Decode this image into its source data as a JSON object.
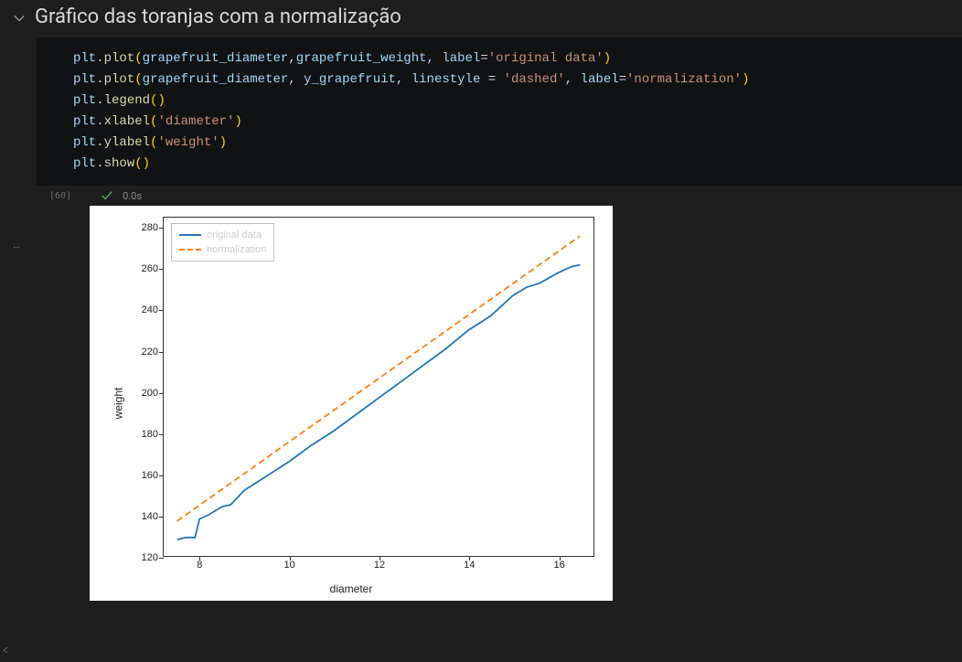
{
  "header": {
    "title": "Gráfico das toranjas com a normalização"
  },
  "code": {
    "obj": "plt",
    "dot": ".",
    "plot": "plot",
    "legend": "legend",
    "xlabel": "xlabel",
    "ylabel": "ylabel",
    "show": "show",
    "comma": ",",
    "eq": "=",
    "sp": " ",
    "lpar": "(",
    "rpar": ")",
    "grapefruit_diameter": "grapefruit_diameter",
    "grapefruit_weight": "grapefruit_weight",
    "y_grapefruit": "y_grapefruit",
    "label": "label",
    "linestyle": "linestyle",
    "str_original": "'original data'",
    "str_dashed": "'dashed'",
    "str_normalization": "'normalization'",
    "str_diameter": "'diameter'",
    "str_weight": "'weight'"
  },
  "exec": {
    "count": "[60]",
    "time": "0.0s"
  },
  "dots": "…",
  "chart_data": {
    "type": "line",
    "xlabel": "diameter",
    "ylabel": "weight",
    "xlim": [
      7.2,
      16.8
    ],
    "ylim": [
      120,
      285
    ],
    "xticks": [
      8,
      10,
      12,
      14,
      16
    ],
    "yticks": [
      120,
      140,
      160,
      180,
      200,
      220,
      240,
      260,
      280
    ],
    "legend": {
      "position": "upper-left",
      "entries": [
        "original data",
        "normalization"
      ]
    },
    "series": [
      {
        "name": "original data",
        "color": "#1f77b4",
        "style": "solid",
        "x": [
          7.5,
          7.7,
          7.9,
          8.0,
          8.2,
          8.5,
          8.7,
          9.0,
          9.5,
          10.0,
          10.5,
          11.0,
          11.5,
          12.0,
          12.5,
          13.0,
          13.5,
          14.0,
          14.5,
          15.0,
          15.3,
          15.6,
          16.0,
          16.3,
          16.5
        ],
        "y": [
          128,
          129,
          129,
          138,
          140,
          144,
          145,
          152,
          159,
          166,
          174,
          181,
          189,
          197,
          205,
          213,
          221,
          230,
          237,
          247,
          251,
          253,
          258,
          261,
          262
        ]
      },
      {
        "name": "normalization",
        "color": "#ff7f0e",
        "style": "dashed",
        "x": [
          7.5,
          16.5
        ],
        "y": [
          137,
          276
        ]
      }
    ]
  }
}
